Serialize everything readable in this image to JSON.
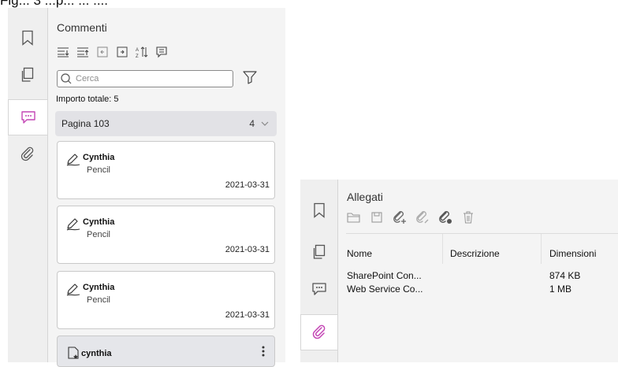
{
  "top_text": "Fig... 3   ...p...   ... ....",
  "left_rail": {
    "items": [
      {
        "icon": "bookmark-icon"
      },
      {
        "icon": "pages-icon"
      },
      {
        "icon": "comment-icon",
        "active": true
      },
      {
        "icon": "paperclip-icon"
      }
    ]
  },
  "comments_panel": {
    "title": "Commenti",
    "toolbar": [
      "expand-all-icon",
      "collapse-all-icon",
      "collapse-icon",
      "expand-icon",
      "sort-icon",
      "comment-list-icon"
    ],
    "search_placeholder": "Cerca",
    "total_label": "Importo totale: 5",
    "group": {
      "label": "Pagina 103",
      "count": "4"
    },
    "items": [
      {
        "author": "Cynthia",
        "type": "Pencil",
        "date": "2021-03-31",
        "icon": "pencil-icon"
      },
      {
        "author": "Cynthia",
        "type": "Pencil",
        "date": "2021-03-31",
        "icon": "pencil-icon"
      },
      {
        "author": "Cynthia",
        "type": "Pencil",
        "date": "2021-03-31",
        "icon": "pencil-icon"
      },
      {
        "author": "cynthia",
        "icon": "stamp-icon"
      }
    ]
  },
  "attachments_panel": {
    "title": "Allegati",
    "toolbar": [
      "open-folder-icon",
      "save-icon",
      "add-attachment-icon",
      "edit-attachment-icon",
      "remove-attachment-icon",
      "delete-icon"
    ],
    "columns": [
      "Nome",
      "Descrizione",
      "Dimensioni"
    ],
    "rows": [
      {
        "name": "SharePoint Con...",
        "description": "",
        "size": "874 KB"
      },
      {
        "name": "Web Service Co...",
        "description": "",
        "size": "1 MB"
      }
    ]
  },
  "colors": {
    "accent": "#c447b5",
    "rail_bg": "#efefef",
    "panel_bg": "#f4f4f4",
    "group_bg": "#e2e2e6"
  }
}
